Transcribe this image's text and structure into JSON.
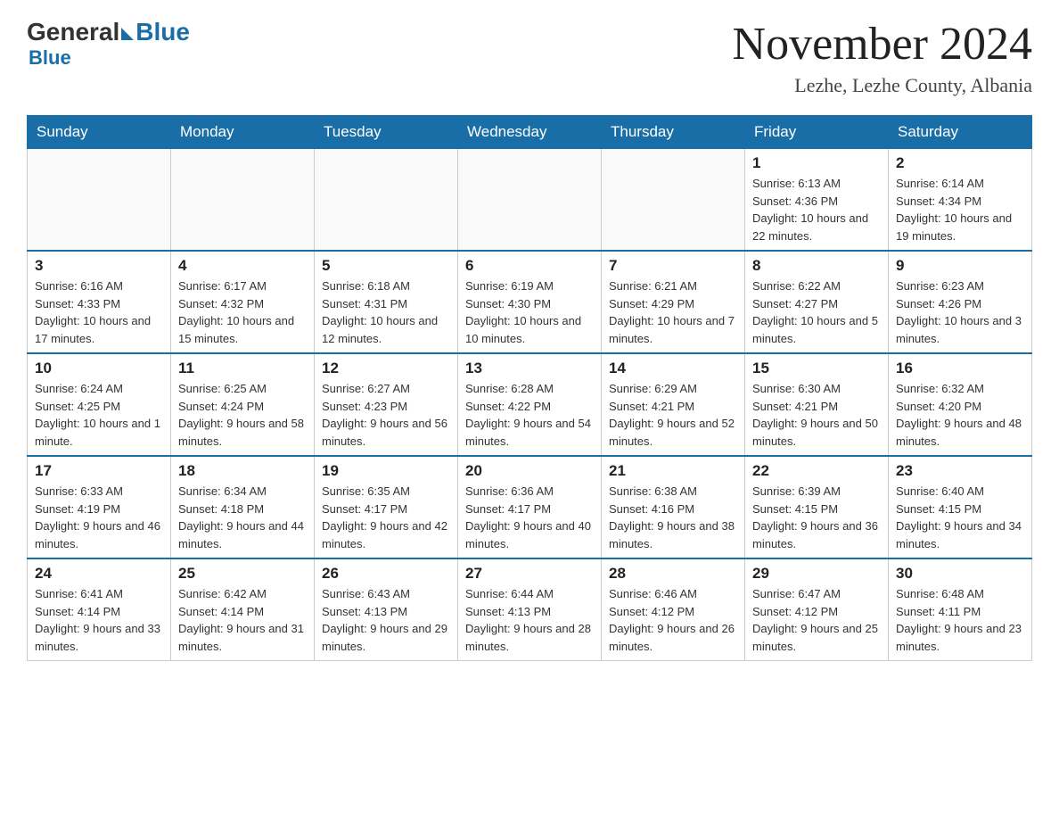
{
  "header": {
    "logo_general": "General",
    "logo_blue": "Blue",
    "month_title": "November 2024",
    "location": "Lezhe, Lezhe County, Albania"
  },
  "days_of_week": [
    "Sunday",
    "Monday",
    "Tuesday",
    "Wednesday",
    "Thursday",
    "Friday",
    "Saturday"
  ],
  "weeks": [
    [
      {
        "day": "",
        "info": ""
      },
      {
        "day": "",
        "info": ""
      },
      {
        "day": "",
        "info": ""
      },
      {
        "day": "",
        "info": ""
      },
      {
        "day": "",
        "info": ""
      },
      {
        "day": "1",
        "info": "Sunrise: 6:13 AM\nSunset: 4:36 PM\nDaylight: 10 hours and 22 minutes."
      },
      {
        "day": "2",
        "info": "Sunrise: 6:14 AM\nSunset: 4:34 PM\nDaylight: 10 hours and 19 minutes."
      }
    ],
    [
      {
        "day": "3",
        "info": "Sunrise: 6:16 AM\nSunset: 4:33 PM\nDaylight: 10 hours and 17 minutes."
      },
      {
        "day": "4",
        "info": "Sunrise: 6:17 AM\nSunset: 4:32 PM\nDaylight: 10 hours and 15 minutes."
      },
      {
        "day": "5",
        "info": "Sunrise: 6:18 AM\nSunset: 4:31 PM\nDaylight: 10 hours and 12 minutes."
      },
      {
        "day": "6",
        "info": "Sunrise: 6:19 AM\nSunset: 4:30 PM\nDaylight: 10 hours and 10 minutes."
      },
      {
        "day": "7",
        "info": "Sunrise: 6:21 AM\nSunset: 4:29 PM\nDaylight: 10 hours and 7 minutes."
      },
      {
        "day": "8",
        "info": "Sunrise: 6:22 AM\nSunset: 4:27 PM\nDaylight: 10 hours and 5 minutes."
      },
      {
        "day": "9",
        "info": "Sunrise: 6:23 AM\nSunset: 4:26 PM\nDaylight: 10 hours and 3 minutes."
      }
    ],
    [
      {
        "day": "10",
        "info": "Sunrise: 6:24 AM\nSunset: 4:25 PM\nDaylight: 10 hours and 1 minute."
      },
      {
        "day": "11",
        "info": "Sunrise: 6:25 AM\nSunset: 4:24 PM\nDaylight: 9 hours and 58 minutes."
      },
      {
        "day": "12",
        "info": "Sunrise: 6:27 AM\nSunset: 4:23 PM\nDaylight: 9 hours and 56 minutes."
      },
      {
        "day": "13",
        "info": "Sunrise: 6:28 AM\nSunset: 4:22 PM\nDaylight: 9 hours and 54 minutes."
      },
      {
        "day": "14",
        "info": "Sunrise: 6:29 AM\nSunset: 4:21 PM\nDaylight: 9 hours and 52 minutes."
      },
      {
        "day": "15",
        "info": "Sunrise: 6:30 AM\nSunset: 4:21 PM\nDaylight: 9 hours and 50 minutes."
      },
      {
        "day": "16",
        "info": "Sunrise: 6:32 AM\nSunset: 4:20 PM\nDaylight: 9 hours and 48 minutes."
      }
    ],
    [
      {
        "day": "17",
        "info": "Sunrise: 6:33 AM\nSunset: 4:19 PM\nDaylight: 9 hours and 46 minutes."
      },
      {
        "day": "18",
        "info": "Sunrise: 6:34 AM\nSunset: 4:18 PM\nDaylight: 9 hours and 44 minutes."
      },
      {
        "day": "19",
        "info": "Sunrise: 6:35 AM\nSunset: 4:17 PM\nDaylight: 9 hours and 42 minutes."
      },
      {
        "day": "20",
        "info": "Sunrise: 6:36 AM\nSunset: 4:17 PM\nDaylight: 9 hours and 40 minutes."
      },
      {
        "day": "21",
        "info": "Sunrise: 6:38 AM\nSunset: 4:16 PM\nDaylight: 9 hours and 38 minutes."
      },
      {
        "day": "22",
        "info": "Sunrise: 6:39 AM\nSunset: 4:15 PM\nDaylight: 9 hours and 36 minutes."
      },
      {
        "day": "23",
        "info": "Sunrise: 6:40 AM\nSunset: 4:15 PM\nDaylight: 9 hours and 34 minutes."
      }
    ],
    [
      {
        "day": "24",
        "info": "Sunrise: 6:41 AM\nSunset: 4:14 PM\nDaylight: 9 hours and 33 minutes."
      },
      {
        "day": "25",
        "info": "Sunrise: 6:42 AM\nSunset: 4:14 PM\nDaylight: 9 hours and 31 minutes."
      },
      {
        "day": "26",
        "info": "Sunrise: 6:43 AM\nSunset: 4:13 PM\nDaylight: 9 hours and 29 minutes."
      },
      {
        "day": "27",
        "info": "Sunrise: 6:44 AM\nSunset: 4:13 PM\nDaylight: 9 hours and 28 minutes."
      },
      {
        "day": "28",
        "info": "Sunrise: 6:46 AM\nSunset: 4:12 PM\nDaylight: 9 hours and 26 minutes."
      },
      {
        "day": "29",
        "info": "Sunrise: 6:47 AM\nSunset: 4:12 PM\nDaylight: 9 hours and 25 minutes."
      },
      {
        "day": "30",
        "info": "Sunrise: 6:48 AM\nSunset: 4:11 PM\nDaylight: 9 hours and 23 minutes."
      }
    ]
  ]
}
